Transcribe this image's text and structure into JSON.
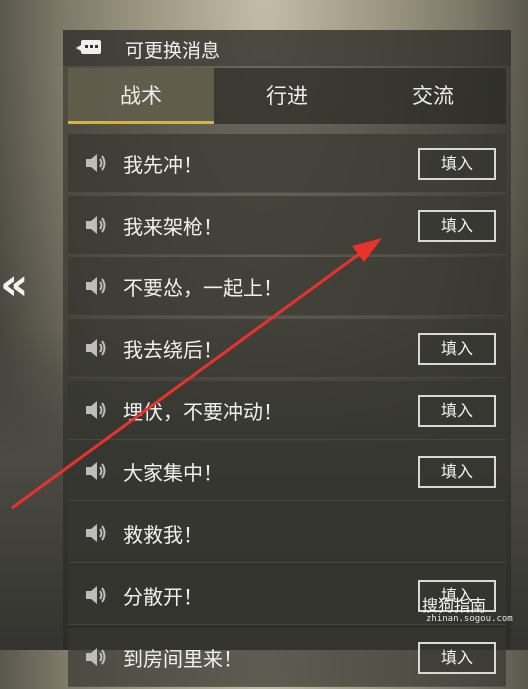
{
  "header": {
    "title": "可更换消息",
    "icon": "chat-bubble-icon"
  },
  "tabs": [
    {
      "label": "战术",
      "active": true
    },
    {
      "label": "行进",
      "active": false
    },
    {
      "label": "交流",
      "active": false
    }
  ],
  "messages": [
    {
      "text": "我先冲！",
      "has_fill": true,
      "fill_label": "填入"
    },
    {
      "text": "我来架枪！",
      "has_fill": true,
      "fill_label": "填入"
    },
    {
      "text": "不要怂，一起上！",
      "has_fill": false,
      "fill_label": ""
    },
    {
      "text": "我去绕后！",
      "has_fill": true,
      "fill_label": "填入"
    },
    {
      "text": "埋伏，不要冲动！",
      "has_fill": true,
      "fill_label": "填入"
    },
    {
      "text": "大家集中！",
      "has_fill": true,
      "fill_label": "填入"
    },
    {
      "text": "救救我！",
      "has_fill": false,
      "fill_label": ""
    },
    {
      "text": "分散开！",
      "has_fill": true,
      "fill_label": "填入"
    },
    {
      "text": "到房间里来！",
      "has_fill": true,
      "fill_label": "填入"
    }
  ],
  "watermark": {
    "logo": "搜狗指南",
    "url": "zhinan.sogou.com"
  },
  "colors": {
    "accent": "#d1b34a",
    "arrow": "#e8332d"
  }
}
